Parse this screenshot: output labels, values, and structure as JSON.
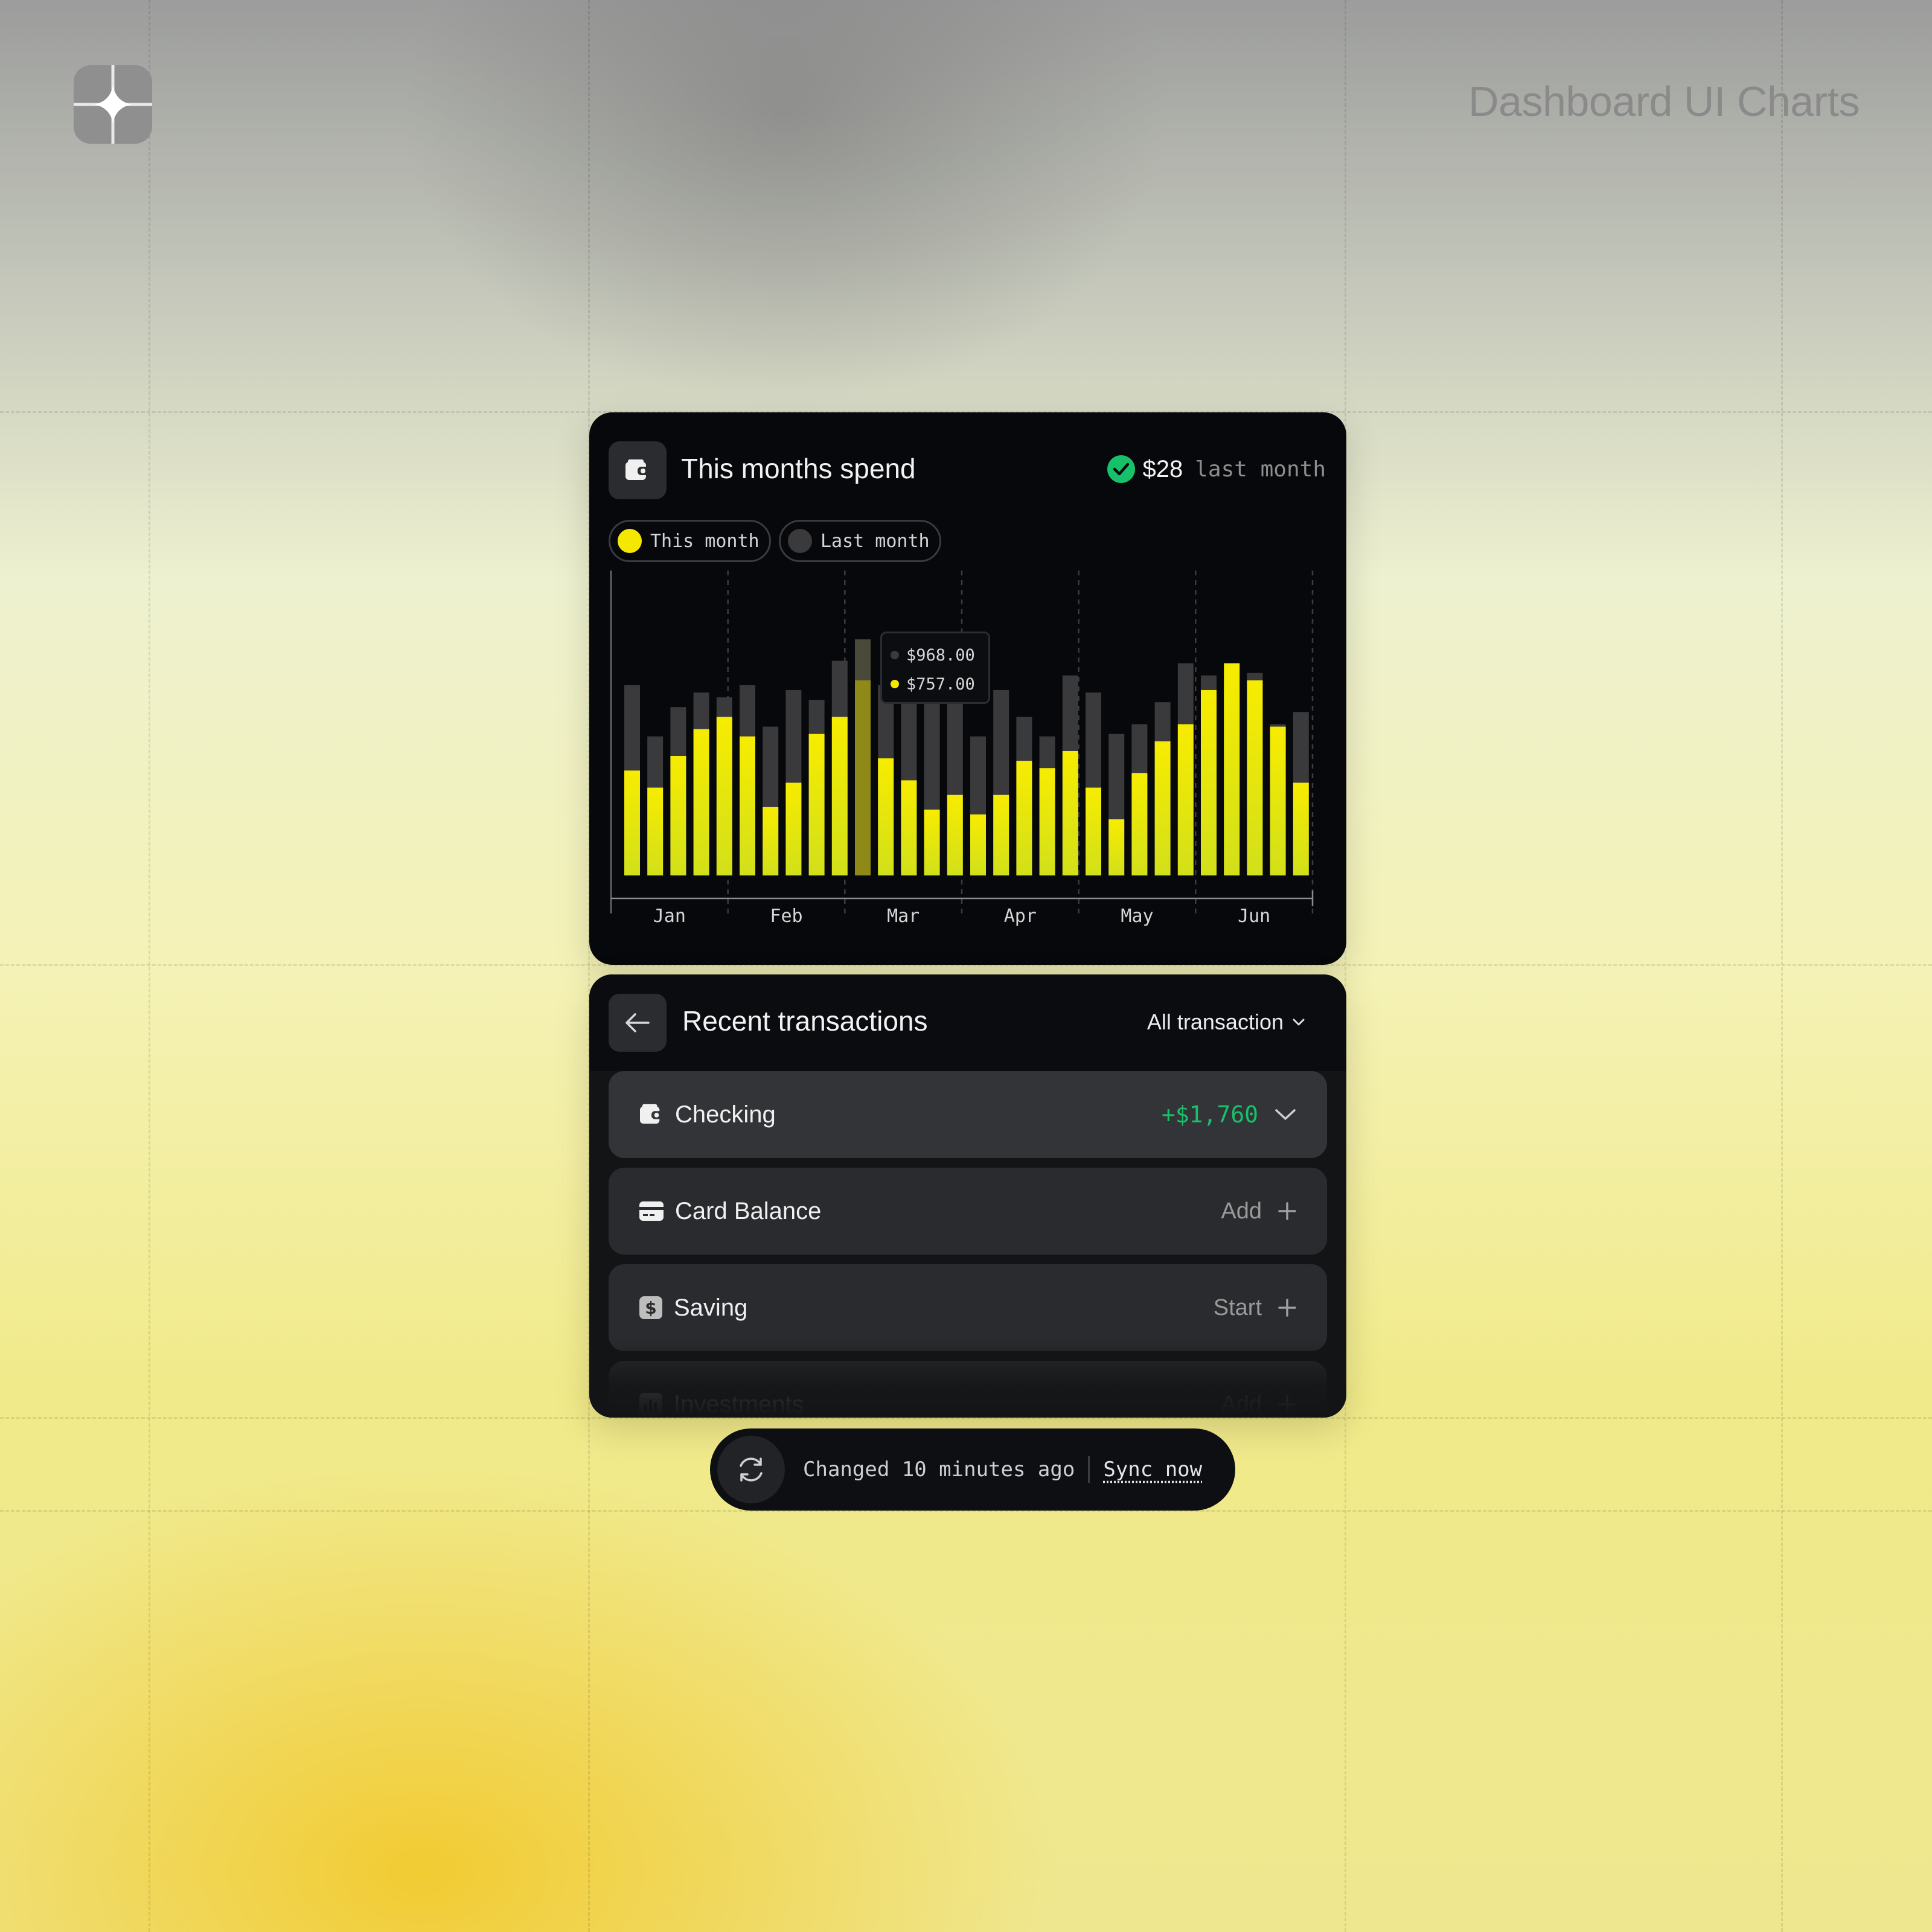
{
  "brand": {
    "title": "Dashboard UI Charts"
  },
  "spend_card": {
    "title": "This months spend",
    "status_amount": "$28",
    "status_suffix": "last month",
    "legend": [
      {
        "label": "This month",
        "color": "#f5e800"
      },
      {
        "label": "Last month",
        "color": "#3a3a3c"
      }
    ],
    "tooltip": {
      "last_month": "$968.00",
      "this_month": "$757.00"
    }
  },
  "chart_data": {
    "type": "bar",
    "categories": [
      "Jan",
      "Feb",
      "Mar",
      "Apr",
      "May",
      "Jun"
    ],
    "highlight_index": 10,
    "series": [
      {
        "name": "This month",
        "color": "#f5e800",
        "values": [
          430,
          360,
          490,
          600,
          650,
          570,
          280,
          380,
          580,
          650,
          800,
          480,
          390,
          270,
          330,
          250,
          330,
          470,
          440,
          510,
          360,
          230,
          420,
          550,
          620,
          760,
          870,
          800,
          610,
          380
        ]
      },
      {
        "name": "Last month",
        "color": "#3a3a3c",
        "values": [
          780,
          570,
          690,
          750,
          730,
          780,
          610,
          760,
          720,
          880,
          968,
          780,
          750,
          730,
          770,
          570,
          760,
          650,
          570,
          820,
          750,
          580,
          620,
          710,
          870,
          820,
          770,
          830,
          620,
          670
        ]
      }
    ],
    "ylim": [
      0,
      1250
    ],
    "grid": true
  },
  "transactions": {
    "title": "Recent transactions",
    "filter_label": "All transaction",
    "rows": [
      {
        "label": "Checking",
        "value": "+$1,760",
        "icon": "wallet-icon"
      },
      {
        "label": "Card Balance",
        "value": "Add",
        "icon": "card-icon"
      },
      {
        "label": "Saving",
        "value": "Start",
        "icon": "dollar-icon"
      },
      {
        "label": "Investments",
        "value": "Add",
        "icon": "bar-chart-icon"
      }
    ]
  },
  "sync": {
    "status": "Changed 10 minutes ago",
    "action": "Sync now"
  }
}
